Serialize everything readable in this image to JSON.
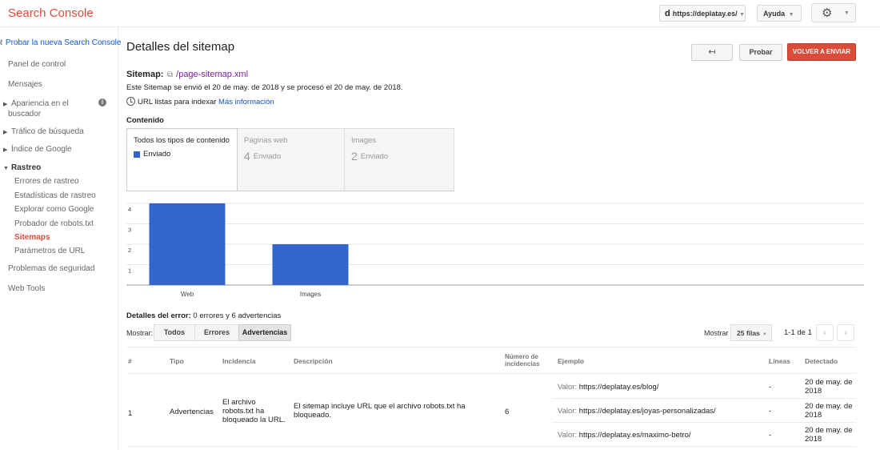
{
  "header": {
    "brand": "Search Console",
    "property": "https://deplatay.es/",
    "property_logo": "d",
    "help_label": "Ayuda",
    "settings_icon": "gear-icon"
  },
  "sidebar": {
    "new_console_link": "Probar la nueva Search Console",
    "items": [
      {
        "label": "Panel de control"
      },
      {
        "label": "Mensajes"
      },
      {
        "label": "Apariencia en el",
        "label2": "buscador"
      },
      {
        "label": "Tráfico de búsqueda"
      },
      {
        "label": "Índice de Google"
      },
      {
        "label": "Rastreo"
      },
      {
        "label": "Problemas de seguridad"
      },
      {
        "label": "Web Tools"
      }
    ],
    "crawl_subitems": [
      {
        "label": "Errores de rastreo"
      },
      {
        "label": "Estadísticas de rastreo"
      },
      {
        "label": "Explorar como Google"
      },
      {
        "label": "Probador de robots.txt"
      },
      {
        "label": "Sitemaps"
      },
      {
        "label": "Parámetros de URL"
      }
    ]
  },
  "main": {
    "title": "Detalles del sitemap",
    "back_icon": "↤",
    "test_button": "Probar",
    "resend_button": "VOLVER A ENVIAR",
    "sitemap_label": "Sitemap:",
    "sitemap_path": "/page-sitemap.xml",
    "sitemap_info": "Este Sitemap se envió el 20 de may. de 2018 y se procesó el 20 de may. de 2018.",
    "url_index_text": "URL listas para indexar",
    "more_info_link": "Más información",
    "content_label": "Contenido",
    "tabs": [
      {
        "title": "Todos los tipos de contenido",
        "legend": "Enviado"
      },
      {
        "title": "Páginas web",
        "count": "4",
        "status": "Enviado"
      },
      {
        "title": "Images",
        "count": "2",
        "status": "Enviado"
      }
    ],
    "accent_color": "#dd4b39",
    "bar_color": "#3366cc"
  },
  "chart_data": {
    "type": "bar",
    "categories": [
      "Web",
      "Images"
    ],
    "series": [
      {
        "name": "Enviado",
        "values": [
          4,
          2
        ]
      }
    ],
    "yticks": [
      "1",
      "2",
      "3",
      "4"
    ],
    "ylim": [
      0,
      4
    ],
    "grid": true
  },
  "errors": {
    "title_bold": "Detalles del error:",
    "title_rest": " 0 errores y 6 advertencias",
    "show_label": "Mostrar:",
    "filters": [
      "Todos",
      "Errores",
      "Advertencias"
    ],
    "rows_label": "Mostrar",
    "rows_value": "25 filas",
    "pager": "1-1 de 1",
    "columns": {
      "num": "#",
      "tipo": "Tipo",
      "incidencia": "Incidencia",
      "descripcion": "Descripción",
      "count_l1": "Número de",
      "count_l2": "incidencias",
      "ejemplo": "Ejemplo",
      "lineas": "Líneas",
      "detectado": "Detectado"
    },
    "row": {
      "num": "1",
      "tipo": "Advertencias",
      "incidencia_l1": "El archivo",
      "incidencia_l2": "robots.txt ha",
      "incidencia_l3": "bloqueado la URL.",
      "descripcion_l1": "El sitemap incluye URL que el archivo robots.txt ha",
      "descripcion_l2": "bloqueado.",
      "count": "6",
      "examples": [
        {
          "prefix": "Valor:",
          "url": "https://deplatay.es/blog/",
          "lines": "-",
          "date_l1": "20 de may. de",
          "date_l2": "2018"
        },
        {
          "prefix": "Valor:",
          "url": "https://deplatay.es/joyas-personalizadas/",
          "lines": "-",
          "date_l1": "20 de may. de",
          "date_l2": "2018"
        },
        {
          "prefix": "Valor:",
          "url": "https://deplatay.es/maximo-betro/",
          "lines": "-",
          "date_l1": "20 de may. de",
          "date_l2": "2018"
        }
      ]
    }
  }
}
